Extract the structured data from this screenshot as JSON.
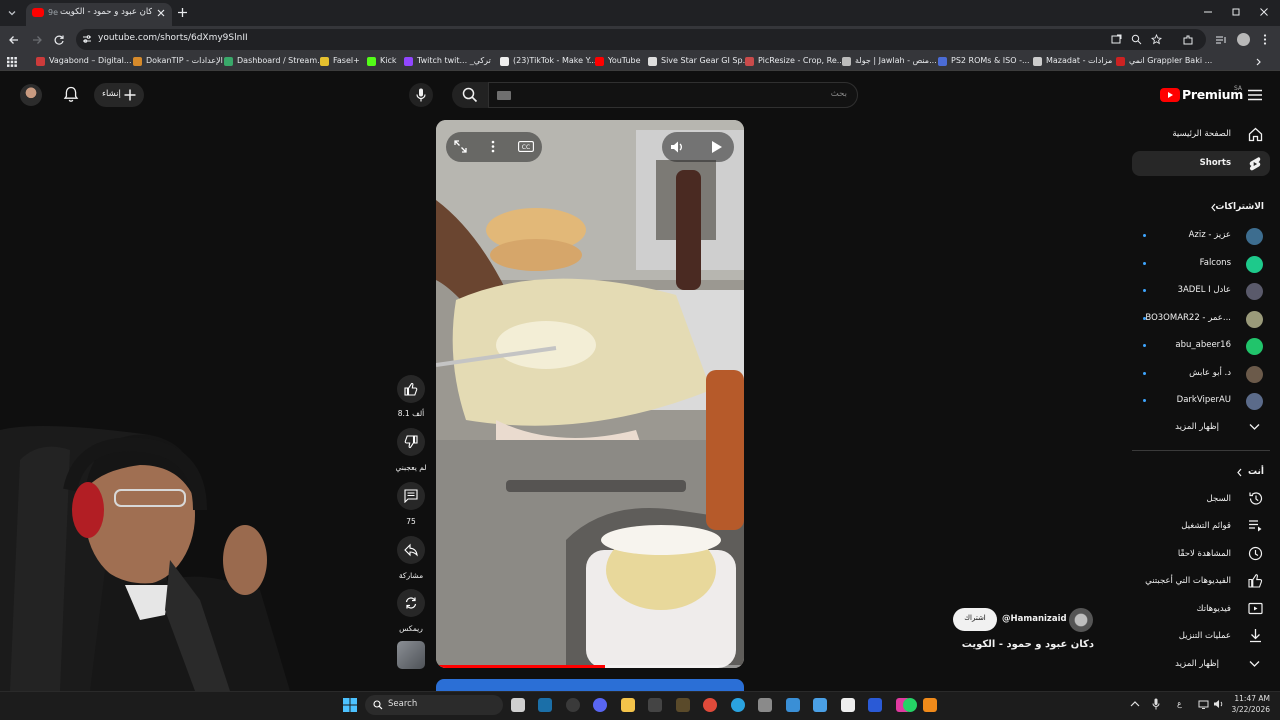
{
  "browser": {
    "tab_title": "دكان عبود و حمود - الكويت",
    "tab_prefix": "9e",
    "url": "youtube.com/shorts/6dXmy9SlnII",
    "bookmarks": [
      {
        "label": "Vagabond – Digital...",
        "color": "#cc3b3b"
      },
      {
        "label": "DokanTIP - الإعدادات",
        "color": "#d68a2b"
      },
      {
        "label": "Dashboard / Stream...",
        "color": "#39a86a"
      },
      {
        "label": "Fasel+",
        "color": "#e6c12f"
      },
      {
        "label": "Kick",
        "color": "#53fc18"
      },
      {
        "label": "Twitch twit... _تركي",
        "color": "#9146ff"
      },
      {
        "label": "(23)TikTok - Make Y...",
        "color": "#eeeeee"
      },
      {
        "label": "YouTube",
        "color": "#ff0000"
      },
      {
        "label": "Sive Star Gear GI Sp...",
        "color": "#dddddd"
      },
      {
        "label": "PicResize - Crop, Re...",
        "color": "#c94b4b"
      },
      {
        "label": "جولة | Jawlah - منص...",
        "color": "#bbbbbb"
      },
      {
        "label": "PS2 ROMs & ISO -...",
        "color": "#4b6cd6"
      },
      {
        "label": "Mazadat - مزادات",
        "color": "#cccccc"
      },
      {
        "label": "انمي Grappler Baki ...",
        "color": "#cc2222"
      }
    ]
  },
  "header": {
    "search_placeholder": "بحث",
    "create_label": "إنشاء",
    "premium_label": "Premium",
    "region": "SA"
  },
  "sidebar": {
    "main": [
      {
        "label": "الصفحة الرئيسية",
        "icon": "home-icon"
      },
      {
        "label": "Shorts",
        "icon": "shorts-icon"
      }
    ],
    "subscriptions_title": "الاشتراكات",
    "subscriptions": [
      {
        "label": "Aziz - عزيز",
        "color": "#3d6d8f"
      },
      {
        "label": "Falcons",
        "color": "#1ec98b"
      },
      {
        "label": "3ADEL I عادل",
        "color": "#5a5a6b"
      },
      {
        "label": "BO3OMAR22 - عمر...",
        "color": "#9a9a7a"
      },
      {
        "label": "abu_abeer16",
        "color": "#21c46b"
      },
      {
        "label": "د. أبو عابش",
        "color": "#6b5a4a"
      },
      {
        "label": "DarkViperAU",
        "color": "#5b6b8a"
      }
    ],
    "show_more": "إظهار المزيد",
    "you_title": "أنت",
    "you_items": [
      {
        "label": "السجل",
        "icon": "history-icon"
      },
      {
        "label": "قوائم التشغيل",
        "icon": "playlists-icon"
      },
      {
        "label": "المشاهدة لاحقًا",
        "icon": "watch-later-icon"
      },
      {
        "label": "الفيديوهات التي أعجبتني",
        "icon": "liked-icon"
      },
      {
        "label": "فيديوهاتك",
        "icon": "your-videos-icon"
      },
      {
        "label": "عمليات التنزيل",
        "icon": "downloads-icon"
      }
    ],
    "you_show_more": "إظهار المزيد"
  },
  "short": {
    "likes": "8.1 ألف",
    "dislike_label": "لم يعجبني",
    "comments": "75",
    "share_label": "مشاركة",
    "remix_label": "ريمكس",
    "channel": "@Hamanizaid",
    "subscribe_label": "اشتراك",
    "title": "دكان عبود و حمود - الكويت",
    "progress": 0.55
  },
  "taskbar": {
    "search_label": "Search",
    "time": "11:47 AM",
    "date": "3/22/2026",
    "lang": "ع"
  },
  "colors": {
    "yt_red": "#ff0000",
    "accent_blue": "#3ea6ff",
    "bg": "#0f0f0f"
  }
}
